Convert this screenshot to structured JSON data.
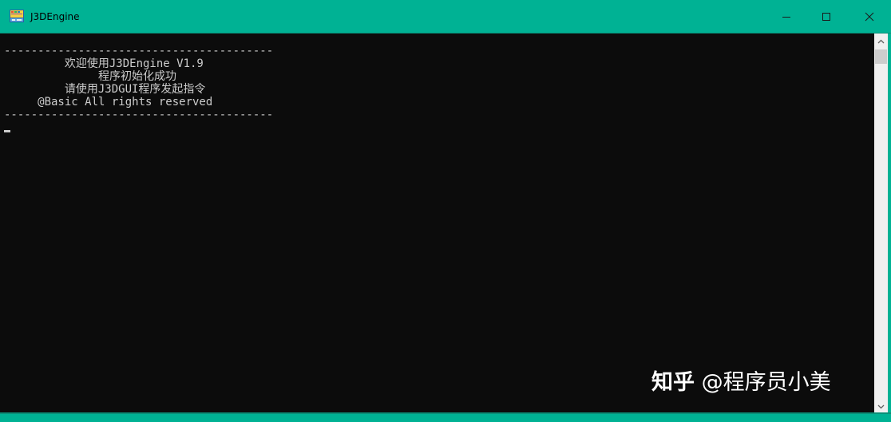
{
  "window": {
    "title": "J3DEngine",
    "titlebar_color": "#00b294",
    "app_icon": "application-icon",
    "controls": {
      "minimize_icon": "minimize-icon",
      "maximize_icon": "maximize-icon",
      "close_icon": "close-icon"
    }
  },
  "console": {
    "background_color": "#0c0c0c",
    "text_color": "#cccccc",
    "lines": [
      "----------------------------------------",
      "         欢迎使用J3DEngine V1.9",
      "              程序初始化成功",
      "         请使用J3DGUI程序发起指令",
      "     @Basic All rights reserved",
      "----------------------------------------"
    ],
    "cursor": "_"
  },
  "scrollbar": {
    "up_icon": "scroll-up-arrow-icon",
    "down_icon": "scroll-down-arrow-icon",
    "thumb_position": 0
  },
  "watermark": {
    "brand": "知乎",
    "author": "@程序员小美"
  }
}
